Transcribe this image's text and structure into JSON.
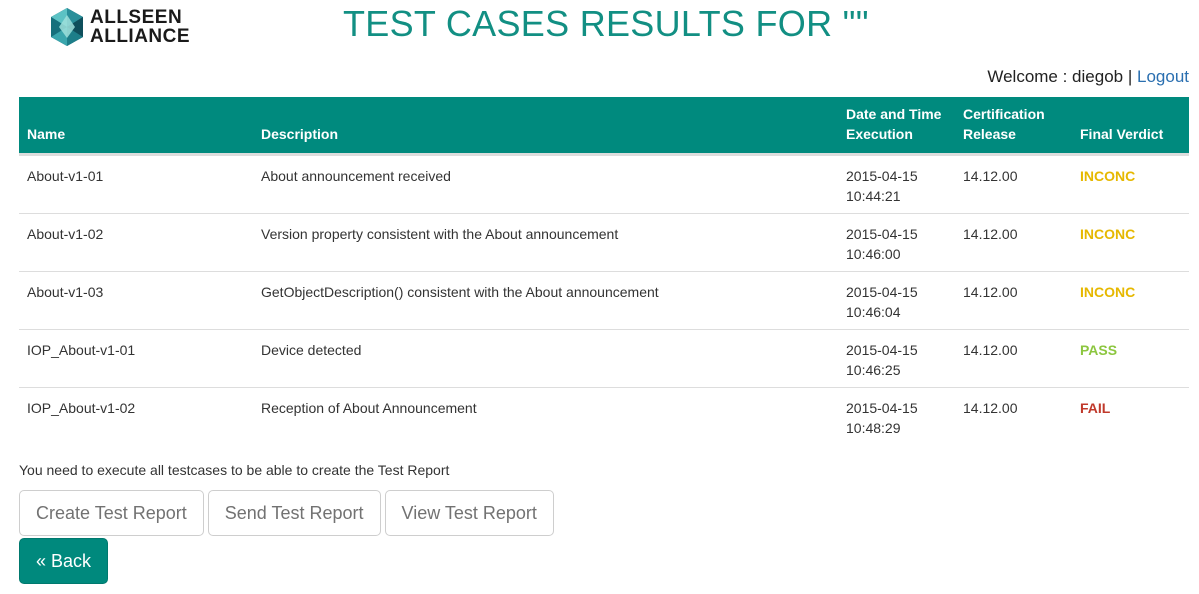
{
  "colors": {
    "brand": "#008a7e",
    "title": "#128f83",
    "link": "#2a6fb0",
    "inconc": "#e6b800",
    "pass": "#8cc63f",
    "fail": "#c0392b"
  },
  "header": {
    "logo_line1": "ALLSEEN",
    "logo_line2": "ALLIANCE",
    "title": "TEST CASES RESULTS FOR \"\"",
    "welcome_label": "Welcome : diegob",
    "separator": "|",
    "logout_label": "Logout"
  },
  "table": {
    "headers": {
      "name": "Name",
      "description": "Description",
      "date_line1": "Date and Time",
      "date_line2": "Execution",
      "release_line1": "Certification",
      "release_line2": "Release",
      "verdict": "Final Verdict"
    },
    "rows": [
      {
        "name": "About-v1-01",
        "description": "About announcement received",
        "date": "2015-04-15",
        "time": "10:44:21",
        "release": "14.12.00",
        "verdict": "INCONC"
      },
      {
        "name": "About-v1-02",
        "description": "Version property consistent with the About announcement",
        "date": "2015-04-15",
        "time": "10:46:00",
        "release": "14.12.00",
        "verdict": "INCONC"
      },
      {
        "name": "About-v1-03",
        "description": "GetObjectDescription() consistent with the About announcement",
        "date": "2015-04-15",
        "time": "10:46:04",
        "release": "14.12.00",
        "verdict": "INCONC"
      },
      {
        "name": "IOP_About-v1-01",
        "description": "Device detected",
        "date": "2015-04-15",
        "time": "10:46:25",
        "release": "14.12.00",
        "verdict": "PASS"
      },
      {
        "name": "IOP_About-v1-02",
        "description": "Reception of About Announcement",
        "date": "2015-04-15",
        "time": "10:48:29",
        "release": "14.12.00",
        "verdict": "FAIL"
      }
    ]
  },
  "footer": {
    "note": "You need to execute all testcases to be able to create the Test Report",
    "create_report_label": "Create Test Report",
    "send_report_label": "Send Test Report",
    "view_report_label": "View Test Report",
    "back_label": "« Back"
  }
}
